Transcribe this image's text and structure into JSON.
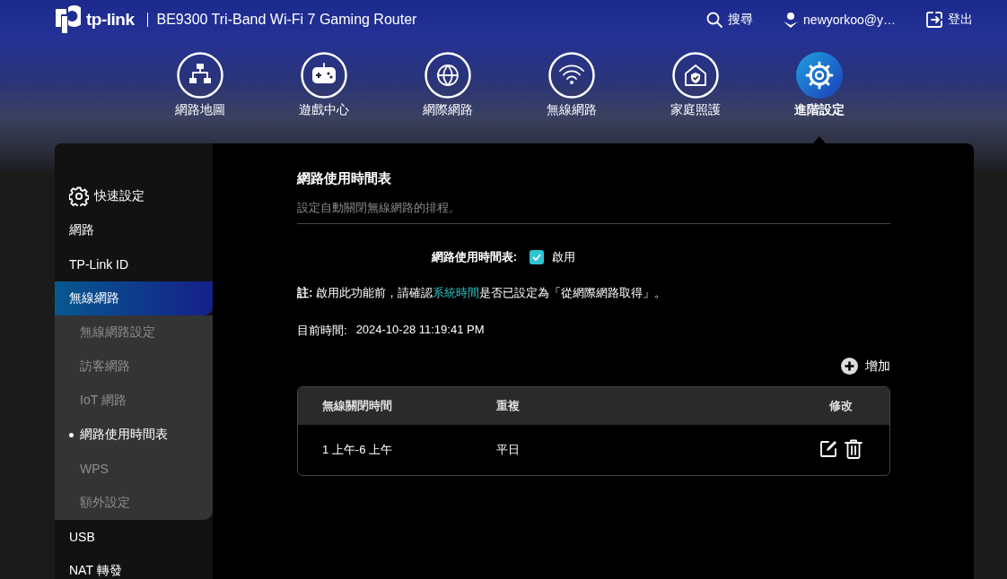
{
  "header": {
    "brand": "tp-link",
    "model": "BE9300 Tri-Band Wi-Fi 7 Gaming Router",
    "actions": [
      {
        "kind": "search",
        "label": "搜尋"
      },
      {
        "kind": "user",
        "label": "newyorkoo@y…"
      },
      {
        "kind": "logout",
        "label": "登出"
      }
    ]
  },
  "nav": [
    {
      "kind": "map",
      "label": "網路地圖",
      "selected": false
    },
    {
      "kind": "game",
      "label": "遊戲中心",
      "selected": false
    },
    {
      "kind": "globe",
      "label": "網際網路",
      "selected": false
    },
    {
      "kind": "wifi",
      "label": "無線網路",
      "selected": false
    },
    {
      "kind": "home",
      "label": "家庭照護",
      "selected": false
    },
    {
      "kind": "gear",
      "label": "進階設定",
      "selected": true
    }
  ],
  "sidebar": {
    "items": [
      {
        "kind": "quick",
        "label": "快速設定",
        "selected": false
      },
      {
        "kind": "plain",
        "label": "網路",
        "selected": false
      },
      {
        "kind": "plain",
        "label": "TP-Link ID",
        "selected": false
      },
      {
        "kind": "plain",
        "label": "無線網路",
        "selected": true,
        "expanded": true,
        "children": [
          {
            "label": "無線網路設定",
            "selected": false
          },
          {
            "label": "訪客網路",
            "selected": false
          },
          {
            "label": "IoT 網路",
            "selected": false
          },
          {
            "label": "網路使用時間表",
            "selected": true
          },
          {
            "label": "WPS",
            "selected": false
          },
          {
            "label": "額外設定",
            "selected": false
          }
        ]
      },
      {
        "kind": "plain",
        "label": "USB",
        "selected": false
      },
      {
        "kind": "plain",
        "label": "NAT 轉發",
        "selected": false
      }
    ]
  },
  "content": {
    "title": "網路使用時間表",
    "description": "設定自動關閉無線網路的排程。",
    "enable": {
      "label": "網路使用時間表:",
      "option": "啟用",
      "checked": true
    },
    "note": {
      "before": "**註:** 啟用此功能前，請確認",
      "link": "系統時間",
      "after": "是否已設定為「從網際網路取得」。"
    },
    "current_time": {
      "label": "目前時間:",
      "value": "2024-10-28 11:19:41 PM"
    },
    "add_button": "增加",
    "table": {
      "columns": [
        "無線關閉時間",
        "重複",
        "修改"
      ],
      "rows": [
        {
          "time": "1 上午-6 上午",
          "repeat": "平日"
        }
      ]
    }
  }
}
